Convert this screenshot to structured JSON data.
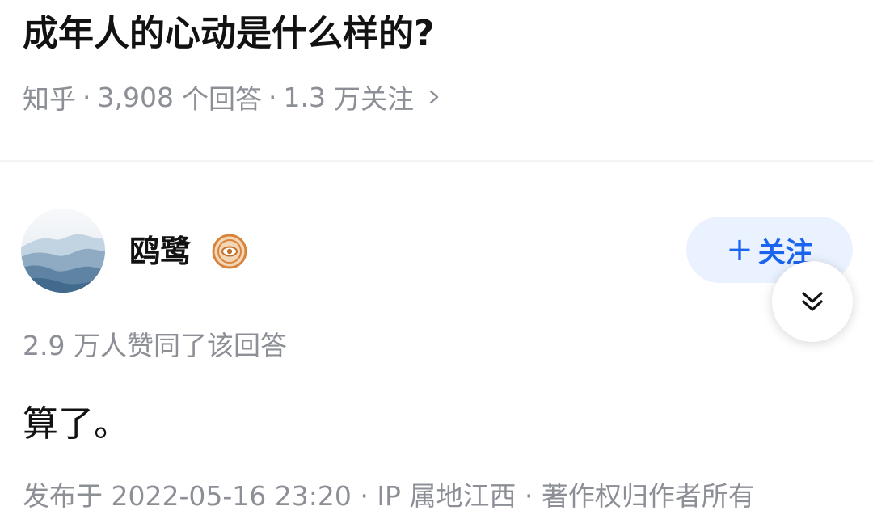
{
  "question": {
    "title": "成年人的心动是什么样的?",
    "source": "知乎",
    "answer_count": "3,908",
    "answer_label": "个回答",
    "follow_count": "1.3",
    "follow_label": "万关注",
    "separator": "·"
  },
  "answer": {
    "author_name": "鸥鹭",
    "follow_button": {
      "plus": "+",
      "label": "关注"
    },
    "vote_text": "2.9 万人赞同了该回答",
    "content": "算了。",
    "footer": "发布于 2022-05-16 23:20 · IP 属地江西 · 著作权归作者所有"
  },
  "icons": {
    "chevron": "chevron-right-icon",
    "badge": "eye-badge-icon",
    "expand": "double-chevron-down-icon"
  },
  "colors": {
    "accent": "#1a64f0",
    "accent_bg": "#eaf2ff",
    "muted_text": "#8c8f96",
    "badge_orange": "#d8843c"
  }
}
